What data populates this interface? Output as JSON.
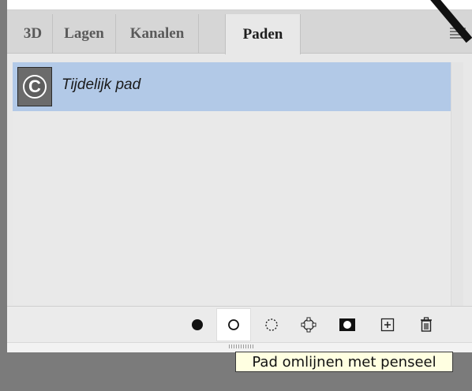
{
  "tabs": [
    {
      "label": "3D",
      "active": false
    },
    {
      "label": "Lagen",
      "active": false
    },
    {
      "label": "Kanalen",
      "active": false
    },
    {
      "label": "Paden",
      "active": true
    }
  ],
  "paths": [
    {
      "name": "Tijdelijk pad",
      "thumbnail_letter": "C",
      "selected": true
    }
  ],
  "bottom_buttons": [
    {
      "icon": "fill-path-icon",
      "tooltip": null
    },
    {
      "icon": "stroke-path-icon",
      "tooltip": "Pad omlijnen met penseel"
    },
    {
      "icon": "load-as-selection-icon",
      "tooltip": null
    },
    {
      "icon": "make-work-path-icon",
      "tooltip": null
    },
    {
      "icon": "add-mask-icon",
      "tooltip": null
    },
    {
      "icon": "new-path-icon",
      "tooltip": null
    },
    {
      "icon": "delete-path-icon",
      "tooltip": null
    }
  ],
  "tooltip": {
    "text": "Pad omlijnen met penseel"
  },
  "colors": {
    "selection": "#b2c9e7",
    "panel_bg": "#e8e8e8",
    "tab_bar": "#d6d6d6",
    "tooltip_bg": "#ffffe1"
  }
}
